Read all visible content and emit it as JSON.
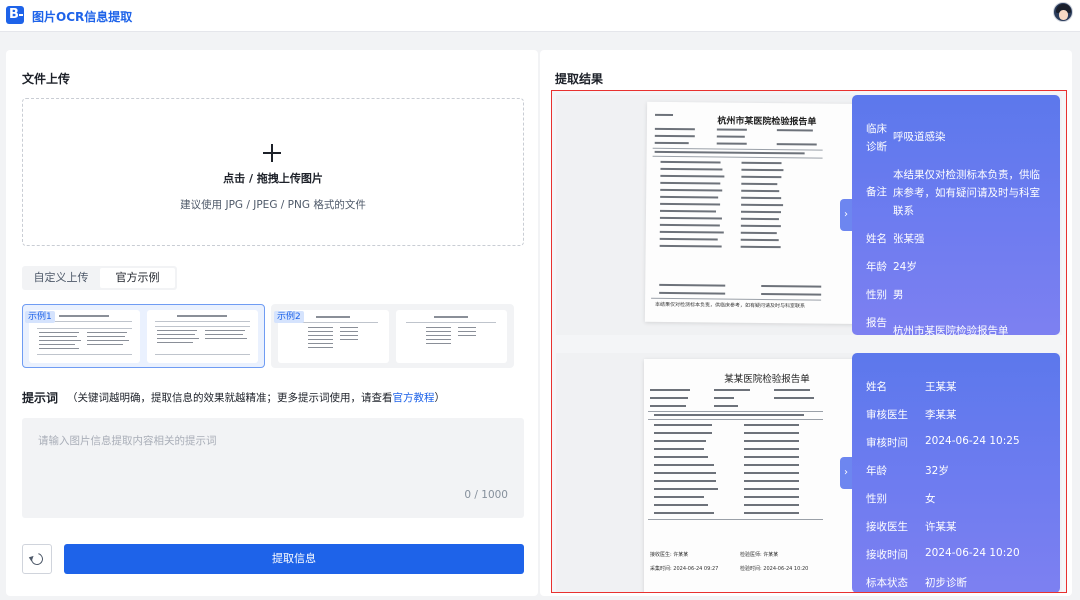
{
  "app": {
    "logo_letter": "B",
    "title": "图片OCR信息提取"
  },
  "upload": {
    "section_title": "文件上传",
    "main_text": "点击 / 拖拽上传图片",
    "hint_text": "建议使用 JPG / JPEG / PNG 格式的文件"
  },
  "tabs": [
    {
      "label": "自定义上传",
      "active": false
    },
    {
      "label": "官方示例",
      "active": true
    }
  ],
  "samples": [
    {
      "tag": "示例1",
      "selected": true
    },
    {
      "tag": "示例2",
      "selected": false
    }
  ],
  "prompt": {
    "label": "提示词",
    "desc_prefix": "（关键词越明确，提取信息的效果就越精准；更多提示词使用，请查看",
    "link": "官方教程",
    "desc_suffix": "）",
    "placeholder": "请输入图片信息提取内容相关的提示词",
    "count": "0 / 1000"
  },
  "actions": {
    "extract_label": "提取信息"
  },
  "result": {
    "section_title": "提取结果",
    "cards": [
      {
        "doc_title": "杭州市某医院检验报告单",
        "doc_footer": "本结果仅对检测标本负责，供临床参考，如有疑问请及时与科室联系",
        "fields": [
          {
            "key": "临床诊断",
            "value": "呼吸道感染"
          },
          {
            "key": "备注",
            "value": "本结果仅对检测标本负责，供临床参考，如有疑问请及时与科室联系"
          },
          {
            "key": "姓名",
            "value": "张某强"
          },
          {
            "key": "年龄",
            "value": "24岁"
          },
          {
            "key": "性别",
            "value": "男"
          },
          {
            "key": "报告",
            "value": "杭州市某医院检验报告单"
          }
        ]
      },
      {
        "doc_title": "某某医院检验报告单",
        "doc_footer_1": "接收医生: 许某某",
        "doc_footer_2": "检验医师: 许某某",
        "doc_footer_3": "采集时间: 2024-06-24 09:27",
        "doc_footer_4": "检验时间: 2024-06-24 10:20",
        "fields": [
          {
            "key": "姓名",
            "value": "王某某"
          },
          {
            "key": "审核医生",
            "value": "李某某"
          },
          {
            "key": "审核时间",
            "value": "2024-06-24 10:25"
          },
          {
            "key": "年龄",
            "value": "32岁"
          },
          {
            "key": "性别",
            "value": "女"
          },
          {
            "key": "接收医生",
            "value": "许某某"
          },
          {
            "key": "接收时间",
            "value": "2024-06-24 10:20"
          },
          {
            "key": "标本状态",
            "value": "初步诊断"
          }
        ]
      }
    ]
  }
}
